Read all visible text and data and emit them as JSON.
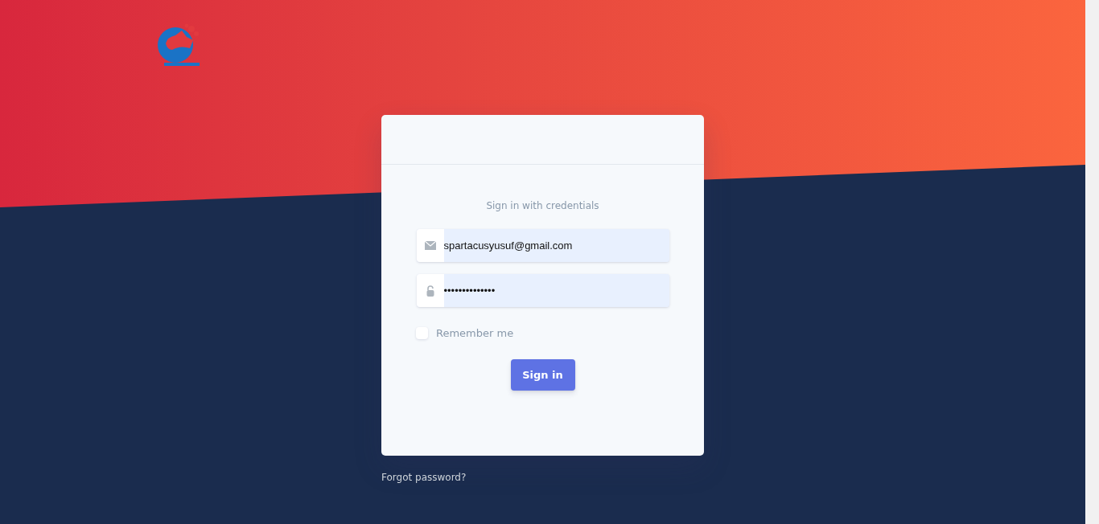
{
  "card": {
    "subtitle": "Sign in with credentials",
    "email": {
      "value": "spartacusyusuf@gmail.com"
    },
    "password": {
      "value": "••••••••••••••"
    },
    "remember": {
      "label": "Remember me",
      "checked": false
    },
    "submit": "Sign in"
  },
  "forgot_link": "Forgot password?"
}
